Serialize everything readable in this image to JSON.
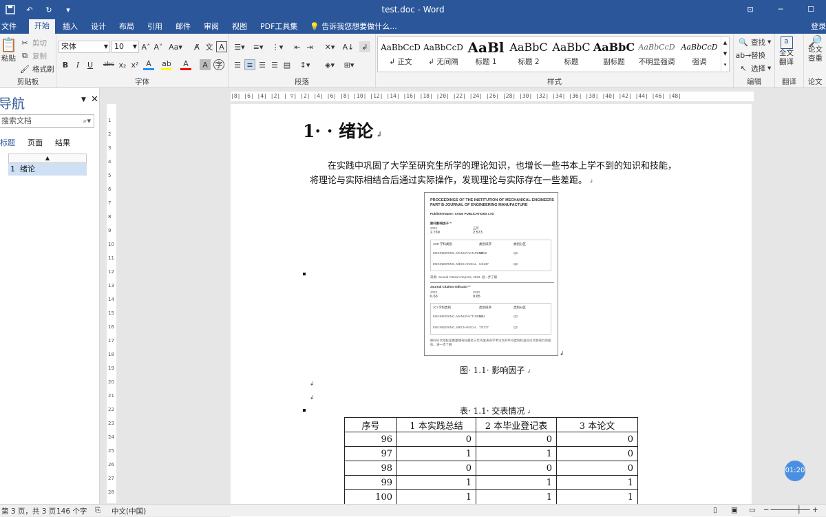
{
  "window": {
    "title": "test.doc - Word"
  },
  "ribbon_tabs": [
    "文件",
    "开始",
    "插入",
    "设计",
    "布局",
    "引用",
    "邮件",
    "审阅",
    "视图",
    "PDF工具集"
  ],
  "tell_me": "告诉我您想要做什么...",
  "signin": "登录",
  "clipboard": {
    "paste": "粘贴",
    "cut": "剪切",
    "copy": "复制",
    "format_painter": "格式刷",
    "label": "剪贴板"
  },
  "font": {
    "name": "宋体",
    "size": "10",
    "label": "字体"
  },
  "paragraph": {
    "label": "段落"
  },
  "styles": {
    "label": "样式",
    "items": [
      {
        "preview": "AaBbCcD",
        "label": "正文"
      },
      {
        "preview": "AaBbCcD",
        "label": "无间隔"
      },
      {
        "preview": "AaBl",
        "label": "标题 1"
      },
      {
        "preview": "AaBbC",
        "label": "标题 2"
      },
      {
        "preview": "AaBbC",
        "label": "标题"
      },
      {
        "preview": "AaBbC",
        "label": "副标题"
      },
      {
        "preview": "AaBbCcD",
        "label": "不明显强调"
      },
      {
        "preview": "AaBbCcD",
        "label": "强调"
      }
    ]
  },
  "editing": {
    "find": "查找",
    "replace": "替换",
    "select": "选择",
    "label": "编辑"
  },
  "translate": {
    "full": "全文",
    "full2": "翻译",
    "label": "翻译"
  },
  "paper": {
    "l1": "论文",
    "l2": "查重",
    "label": "论文"
  },
  "nav": {
    "title": "导航",
    "search_placeholder": "搜索文档",
    "tabs": [
      "标题",
      "页面",
      "结果"
    ],
    "items": [
      {
        "num": "1",
        "text": "绪论"
      }
    ]
  },
  "document": {
    "heading": "1· · 绪论",
    "para_line1": "在实践中巩固了大学至研究生所学的理论知识，也增长一些书本上学不到的知识和技能，",
    "para_line2": "将理论与实际相结合后通过实际操作，发现理论与实际存在一些差距。",
    "figure_caption": "图· 1.1· 影响因子",
    "table_caption": "表· 1.1· 交表情况",
    "figure": {
      "title1": "PROCEEDINGS OF THE INSTITUTION OF MECHANICAL ENGINEERS",
      "title2": "PART B-JOURNAL OF ENGINEERING MANUFACTURE",
      "publisher": "PublisherName: SAGE PUBLICATIONS LTD",
      "if_label": "期刊影响因子™",
      "if_y1": "2023",
      "if_v1": "2.739",
      "if_y2": "五年",
      "if_v2": "2.573",
      "jcr_h1": "JCR 学科类别",
      "jcr_h2": "类别排序",
      "jcr_h3": "类别分区",
      "r1a": "ENGINEERING, MANUFACTURING",
      "r1b": "32/52",
      "r1c": "Q3",
      "r2a": "ENGINEERING, MECHANICAL",
      "r2b": "64/137",
      "r2c": "Q2",
      "src": "来源: Journal Citation Reports, 2023. 进一步了解",
      "jci_label": "Journal Citation Indicator™",
      "jci_y1": "2023",
      "jci_v1": "0.63",
      "jci_y2": "2020",
      "jci_v2": "0.65",
      "jci_h1": "JCI 学科类别",
      "jci_h2": "类别排序",
      "jci_h3": "类别分区",
      "j1a": "ENGINEERING, MANUFACTURING",
      "j1b": "8/54",
      "j1c": "Q3",
      "j2a": "ENGINEERING, MECHANICAL",
      "j2b": "72/177",
      "j2c": "Q2",
      "note": "期刊引文指标是衡量期刊在最近三年内发表的学术论文的平均类别标准化引文影响力的指标。进一步了解"
    },
    "table": {
      "headers": [
        "序号",
        "1 本实践总结",
        "2 本毕业登记表",
        "3 本论文"
      ],
      "rows": [
        [
          "96",
          "0",
          "0",
          "0"
        ],
        [
          "97",
          "1",
          "1",
          "0"
        ],
        [
          "98",
          "0",
          "0",
          "0"
        ],
        [
          "99",
          "1",
          "1",
          "1"
        ],
        [
          "100",
          "1",
          "1",
          "1"
        ]
      ]
    }
  },
  "timer": "01:20",
  "status": {
    "page": "第 3 页，共 3 页",
    "words": "146 个字",
    "lang": "中文(中国)"
  }
}
